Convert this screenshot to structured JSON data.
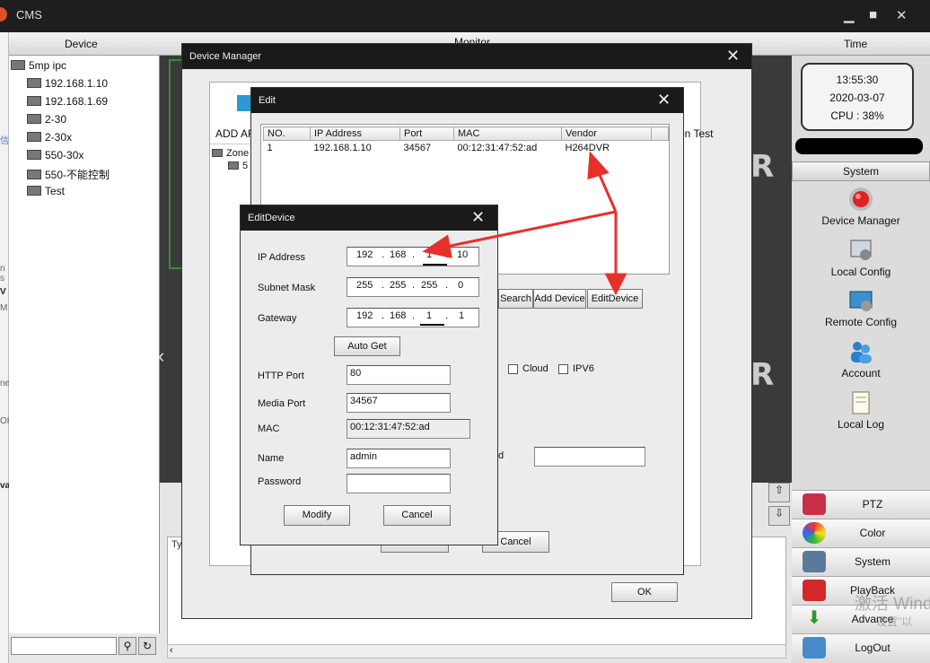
{
  "app": {
    "title": "CMS"
  },
  "header": {
    "device_col": "Device",
    "monitor_col": "Monitor",
    "time_col": "Time"
  },
  "left_edge_texts": [
    "信",
    "n s",
    "V",
    "M",
    "ne",
    "OH",
    "va"
  ],
  "device_tree": {
    "root": "5mp ipc",
    "items": [
      "192.168.1.10",
      "192.168.1.69",
      "2-30",
      "2-30x",
      "550-30x",
      "550-不能控制",
      "Test"
    ]
  },
  "clock": {
    "time": "13:55:30",
    "date": "2020-03-07",
    "cpu": "CPU : 38%"
  },
  "system_panel": {
    "header": "System",
    "items": [
      {
        "label": "Device Manager",
        "icon": "red-record-icon"
      },
      {
        "label": "Local Config",
        "icon": "local-config-icon"
      },
      {
        "label": "Remote Config",
        "icon": "remote-config-icon"
      },
      {
        "label": "Account",
        "icon": "account-icon"
      },
      {
        "label": "Local Log",
        "icon": "local-log-icon"
      }
    ]
  },
  "nav_buttons": [
    {
      "label": "PTZ",
      "icon": "ptz-icon"
    },
    {
      "label": "Color",
      "icon": "color-icon"
    },
    {
      "label": "System",
      "icon": "system-icon"
    },
    {
      "label": "PlayBack",
      "icon": "playback-icon"
    },
    {
      "label": "Advance",
      "icon": "advance-icon"
    },
    {
      "label": "LogOut",
      "icon": "logout-icon"
    }
  ],
  "watermark": {
    "line1": "激活 Wind",
    "line2": "设置\"以"
  },
  "device_manager": {
    "title": "Device Manager",
    "toolbar_left": "ADD AR",
    "toolbar_right": "on Test",
    "tree_zone": "Zone",
    "tree_sub": "5",
    "search_button": "Search",
    "add_device_button": "Add Device",
    "edit_device_button": "EditDevice",
    "cloud_label": "Cloud",
    "ipv6_label": "IPV6",
    "d_label": "d",
    "cancel_button": "Cancel",
    "ok_button": "OK"
  },
  "edit_dialog": {
    "title": "Edit",
    "columns": [
      "NO.",
      "IP Address",
      "Port",
      "MAC",
      "Vendor"
    ],
    "rows": [
      {
        "no": "1",
        "ip": "192.168.1.10",
        "port": "34567",
        "mac": "00:12:31:47:52:ad",
        "vendor": "H264DVR"
      }
    ]
  },
  "edit_device": {
    "title": "EditDevice",
    "ip_label": "IP Address",
    "ip": [
      "192",
      "168",
      "1",
      "10"
    ],
    "subnet_label": "Subnet Mask",
    "subnet": [
      "255",
      "255",
      "255",
      "0"
    ],
    "gateway_label": "Gateway",
    "gateway": [
      "192",
      "168",
      "1",
      "1"
    ],
    "auto_get": "Auto Get",
    "http_port_label": "HTTP Port",
    "http_port": "80",
    "media_port_label": "Media Port",
    "media_port": "34567",
    "mac_label": "MAC",
    "mac": "00:12:31:47:52:ad",
    "name_label": "Name",
    "name": "admin",
    "password_label": "Password",
    "password": "",
    "modify_button": "Modify",
    "cancel_button": "Cancel"
  },
  "colors": {
    "annotation_red": "#e8302a",
    "titlebar": "#1a1a1a",
    "frame_green": "#3c8a3c"
  }
}
